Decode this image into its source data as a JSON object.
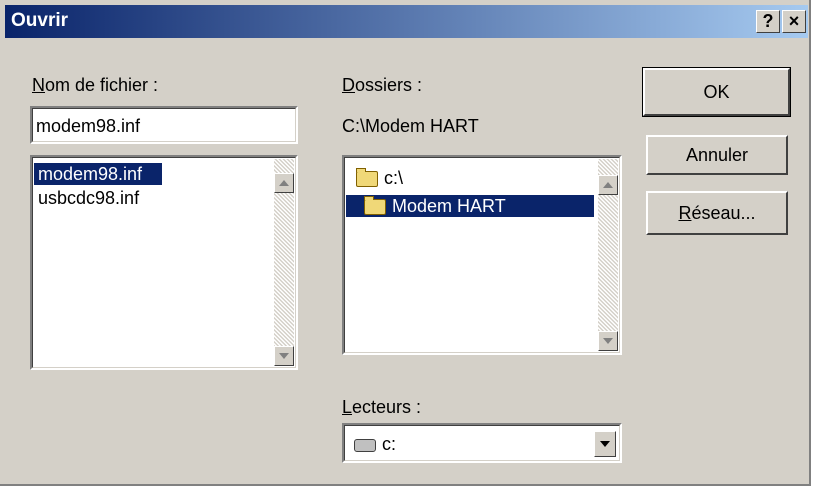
{
  "window": {
    "title": "Ouvrir",
    "help_label": "?",
    "close_label": "×"
  },
  "file_name": {
    "label": "Nom de fichier :",
    "value": "modem98.inf",
    "files": [
      {
        "name": "modem98.inf",
        "selected": true
      },
      {
        "name": "usbcdc98.inf",
        "selected": false
      }
    ]
  },
  "folders": {
    "label": "Dossiers :",
    "current_path": "C:\\Modem HART",
    "items": [
      {
        "name": "c:\\",
        "selected": false,
        "icon": "open-folder-icon"
      },
      {
        "name": "Modem HART",
        "selected": true,
        "icon": "open-folder-icon"
      }
    ]
  },
  "drives": {
    "label": "Lecteurs :",
    "selected": "c:",
    "icon": "drive-icon"
  },
  "buttons": {
    "ok": "OK",
    "cancel": "Annuler",
    "network": "Réseau..."
  }
}
